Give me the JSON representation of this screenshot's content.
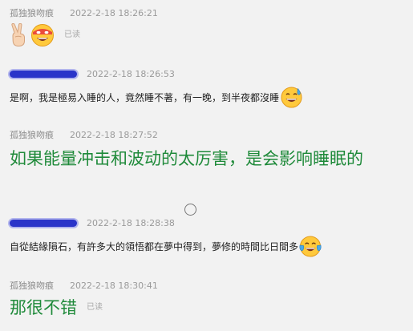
{
  "messages": [
    {
      "sender": "孤独狼吻痕",
      "timestamp": "2022-2-18 18:26:21",
      "read_status": "已读",
      "emojis": [
        "victory-hand-emoji",
        "grinning-face-emoji"
      ]
    },
    {
      "sender": "",
      "timestamp": "2022-2-18 18:26:53",
      "text": "是啊，我是極易入睡的人，竟然睡不著，有一晚，到半夜都沒睡",
      "emojis": [
        "sweat-smile-emoji"
      ]
    },
    {
      "sender": "孤独狼吻痕",
      "timestamp": "2022-2-18 18:27:52",
      "text": "如果能量冲击和波动的太厉害，是会影响睡眠的"
    },
    {
      "sender": "",
      "timestamp": "2022-2-18 18:28:38",
      "text": "自從結緣隕石，有許多大的領悟都在夢中得到，夢修的時間比日間多",
      "emojis": [
        "tears-of-joy-emoji"
      ]
    },
    {
      "sender": "孤独狼吻痕",
      "timestamp": "2022-2-18 18:30:41",
      "text": "那很不错",
      "read_status": "已读"
    }
  ],
  "colors": {
    "background": "#f2f2f2",
    "green_text": "#1f8a3a",
    "redaction": "#2a34c9"
  }
}
